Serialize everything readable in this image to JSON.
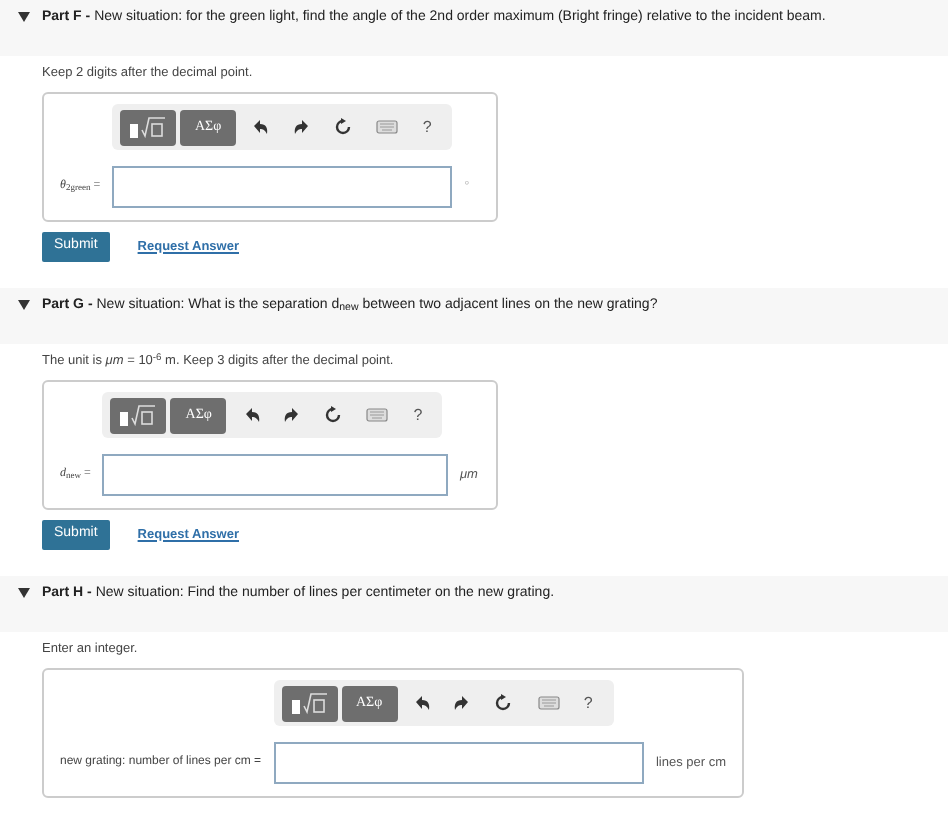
{
  "parts": [
    {
      "expanded": true,
      "title": "Part F -",
      "question": "New situation: for the green light, find the angle of the 2nd order maximum (Bright fringe) relative to the incident beam.",
      "instruction": "Keep 2 digits after the decimal point.",
      "toolbar": {
        "symbols": "ΑΣφ",
        "help": "?"
      },
      "label": "*θ*$_{2green}$ =",
      "unit": "°",
      "actions": [
        {
          "kind": "primary",
          "label": "Submit"
        },
        {
          "kind": "link",
          "label": "Request Answer"
        }
      ]
    },
    {
      "expanded": true,
      "title": "Part G -",
      "question": "New situation: What is the separation d$_{new}$ between two adjacent lines on the new grating?",
      "instruction": "The unit is *μm* = 10$^{-6}$ m. Keep 3 digits after the decimal point.",
      "toolbar": {
        "symbols": "ΑΣφ",
        "help": "?"
      },
      "label": "*d*$_{new}$ =",
      "unit": "*μm*",
      "actions": [
        {
          "kind": "primary",
          "label": "Submit"
        },
        {
          "kind": "link",
          "label": "Request Answer"
        }
      ]
    },
    {
      "expanded": true,
      "title": "Part H -",
      "question": "New situation: Find the number of lines per centimeter on the new grating.",
      "instruction": "Enter an integer.",
      "toolbar": {
        "symbols": "ΑΣφ",
        "help": "?"
      },
      "label": "new grating: number of lines per cm =",
      "unit": "lines per cm"
    }
  ]
}
